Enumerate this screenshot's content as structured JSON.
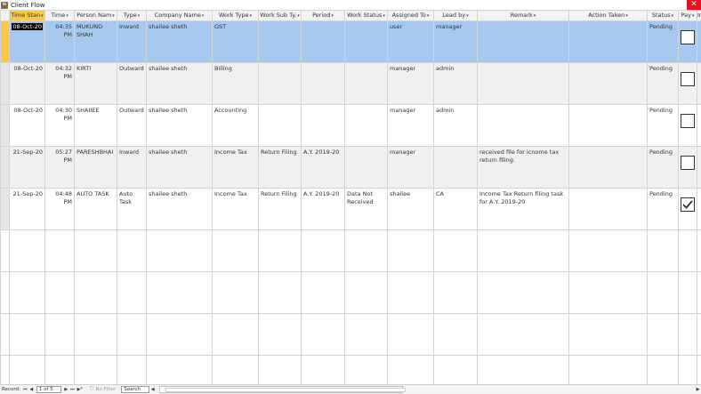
{
  "window": {
    "title": "Client Flow",
    "close_glyph": "✕"
  },
  "columns": [
    {
      "label": "Time Stan",
      "dropdown": true
    },
    {
      "label": "Time",
      "dropdown": true
    },
    {
      "label": "Person Nam",
      "dropdown": true
    },
    {
      "label": "Type",
      "dropdown": true
    },
    {
      "label": "Company Name",
      "dropdown": true
    },
    {
      "label": "Work Type",
      "dropdown": true
    },
    {
      "label": "Work Sub Ty.",
      "dropdown": true
    },
    {
      "label": "Period",
      "dropdown": true
    },
    {
      "label": "Work Status",
      "dropdown": true
    },
    {
      "label": "Assigned To",
      "dropdown": true
    },
    {
      "label": "Lead by",
      "dropdown": true
    },
    {
      "label": "Remark",
      "dropdown": true
    },
    {
      "label": "Action Taken",
      "dropdown": true
    },
    {
      "label": "Status",
      "dropdown": true
    },
    {
      "label": "Pay",
      "dropdown": true
    },
    {
      "label": "In",
      "dropdown": false
    }
  ],
  "dropdown_glyph": "▾",
  "rows": [
    {
      "time_stamp": "08-Oct-20",
      "time": "04:35 PM",
      "person": "MUKUND SHAH",
      "type": "Inward",
      "company": "shailee sheth",
      "work_type": "GST",
      "work_sub_type": "",
      "period": "",
      "work_status": "",
      "assigned_to": "user",
      "lead_by": "manager",
      "remark": "",
      "action_taken": "",
      "status": "Pending",
      "paid": false
    },
    {
      "time_stamp": "08-Oct-20",
      "time": "04:32 PM",
      "person": "KIRTI",
      "type": "Outward",
      "company": "shailee sheth",
      "work_type": "Billing",
      "work_sub_type": "",
      "period": "",
      "work_status": "",
      "assigned_to": "manager",
      "lead_by": "admin",
      "remark": "",
      "action_taken": "",
      "status": "Pending",
      "paid": false
    },
    {
      "time_stamp": "08-Oct-20",
      "time": "04:30 PM",
      "person": "SHAIIEE",
      "type": "Outward",
      "company": "shailee sheth",
      "work_type": "Accounting",
      "work_sub_type": "",
      "period": "",
      "work_status": "",
      "assigned_to": "manager",
      "lead_by": "admin",
      "remark": "",
      "action_taken": "",
      "status": "Pending",
      "paid": false
    },
    {
      "time_stamp": "21-Sep-20",
      "time": "05:27 PM",
      "person": "PARESHBHAI",
      "type": "Inward",
      "company": "shailee sheth",
      "work_type": "Income Tax",
      "work_sub_type": "Return Filing",
      "period": "A.Y. 2019-20",
      "work_status": "",
      "assigned_to": "manager",
      "lead_by": "",
      "remark": "received file for icnome tax return filing.",
      "action_taken": "",
      "status": "Pending",
      "paid": false
    },
    {
      "time_stamp": "21-Sep-20",
      "time": "04:48 PM",
      "person": "AUTO TASK",
      "type": "Auto Task",
      "company": "shailee sheth",
      "work_type": "Income Tax",
      "work_sub_type": "Return Filing",
      "period": "A.Y. 2019-20",
      "work_status": "Data Not Received",
      "assigned_to": "shailee",
      "lead_by": "CA",
      "remark": "Income Tax Return filing task for A.Y. 2019-20",
      "action_taken": "",
      "status": "Pending",
      "paid": true
    }
  ],
  "status_bar": {
    "record_label": "Record:",
    "first_glyph": "⏮",
    "prev_glyph": "◀",
    "position": "1 of 5",
    "next_glyph": "▶",
    "last_glyph": "⏭",
    "new_glyph": "▶*",
    "filter_icon": "funnel-icon",
    "filter_glyph": "⛉",
    "filter_label": "No Filter",
    "search_label": "Search",
    "scroll_left_glyph": "◀",
    "scroll_right_glyph": "▶"
  },
  "colors": {
    "selected_row": "#a6c8ee",
    "active_header": "#f7c948",
    "close_button": "#e81123"
  }
}
